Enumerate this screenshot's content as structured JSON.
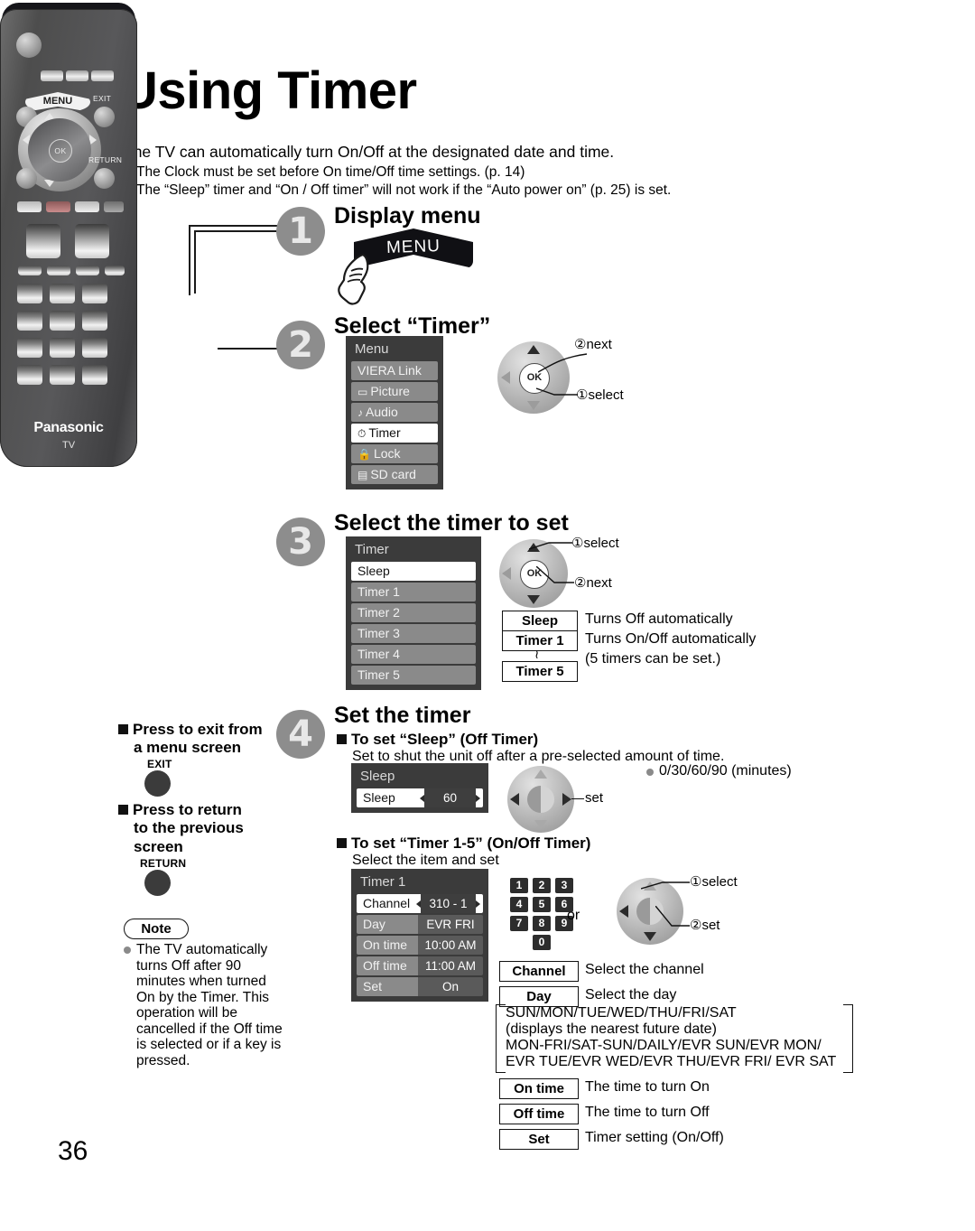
{
  "page": {
    "title": "Using Timer",
    "number": "36",
    "intro": "The TV can automatically turn On/Off at the designated date and time.",
    "intro_bullets": [
      "The Clock must be set before On time/Off time settings. (p. 14)",
      "The “Sleep” timer and “On / Off timer” will not work if the “Auto power on” (p. 25) is set."
    ]
  },
  "remote": {
    "menu_key": "MENU",
    "ok_key": "OK",
    "exit_key": "EXIT",
    "return_key": "RETURN",
    "brand": "Panasonic",
    "brand_sub": "TV"
  },
  "steps": [
    {
      "num": "1",
      "heading": "Display menu"
    },
    {
      "num": "2",
      "heading": "Select “Timer”"
    },
    {
      "num": "3",
      "heading": "Select the timer to set"
    },
    {
      "num": "4",
      "heading": "Set the timer"
    }
  ],
  "step1": {
    "button_label": "MENU"
  },
  "step2": {
    "osd_title": "Menu",
    "items": [
      {
        "icon": "",
        "label": "VIERA Link",
        "selected": false
      },
      {
        "icon": "▭",
        "label": "Picture",
        "selected": false
      },
      {
        "icon": "♪",
        "label": "Audio",
        "selected": false
      },
      {
        "icon": "⏱",
        "label": "Timer",
        "selected": true
      },
      {
        "icon": "🔒",
        "label": "Lock",
        "selected": false
      },
      {
        "icon": "▤",
        "label": "SD card",
        "selected": false
      }
    ],
    "dpad": {
      "ok": "OK",
      "callout_next": "②next",
      "callout_select": "①select"
    }
  },
  "step3": {
    "osd_title": "Timer",
    "items": [
      {
        "label": "Sleep",
        "selected": true
      },
      {
        "label": "Timer 1",
        "selected": false
      },
      {
        "label": "Timer 2",
        "selected": false
      },
      {
        "label": "Timer 3",
        "selected": false
      },
      {
        "label": "Timer 4",
        "selected": false
      },
      {
        "label": "Timer 5",
        "selected": false
      }
    ],
    "dpad": {
      "ok": "OK",
      "callout_select": "①select",
      "callout_next": "②next"
    },
    "legend": [
      {
        "key": "Sleep",
        "desc": "Turns Off automatically"
      },
      {
        "key": "Timer 1",
        "desc": "Turns On/Off automatically"
      },
      {
        "key": "",
        "desc": "(5 timers can be set.)"
      },
      {
        "key": "Timer 5",
        "desc": ""
      }
    ],
    "tilde": "≀"
  },
  "step4": {
    "sleep_section": {
      "heading": "To set “Sleep” (Off Timer)",
      "subtext": "Set to shut the unit off after a pre-selected amount of time.",
      "osd_title": "Sleep",
      "row_key": "Sleep",
      "row_value": "60",
      "dpad_callout": "set",
      "options_note": "0/30/60/90 (minutes)"
    },
    "timer_section": {
      "heading": "To set “Timer 1-5” (On/Off Timer)",
      "subtext": "Select the item and set",
      "osd_title": "Timer 1",
      "rows": [
        {
          "key": "Channel",
          "value": "310 - 1",
          "highlight": true,
          "arrows": true
        },
        {
          "key": "Day",
          "value": "EVR FRI",
          "highlight": false,
          "arrows": false
        },
        {
          "key": "On time",
          "value": "10:00 AM",
          "highlight": false,
          "arrows": false
        },
        {
          "key": "Off time",
          "value": "11:00 AM",
          "highlight": false,
          "arrows": false
        },
        {
          "key": "Set",
          "value": "On",
          "highlight": false,
          "arrows": false
        }
      ],
      "keypad": [
        "1",
        "2",
        "3",
        "4",
        "5",
        "6",
        "7",
        "8",
        "9",
        "0"
      ],
      "or_text": "or",
      "dpad": {
        "callout_select": "①select",
        "callout_set": "②set"
      }
    },
    "legend": [
      {
        "key": "Channel",
        "desc": "Select the channel"
      },
      {
        "key": "Day",
        "desc": "Select the day"
      },
      {
        "key": "On time",
        "desc": "The time to turn On"
      },
      {
        "key": "Off time",
        "desc": "The time to turn Off"
      },
      {
        "key": "Set",
        "desc": "Timer setting (On/Off)"
      }
    ],
    "day_options": [
      "SUN/MON/TUE/WED/THU/FRI/SAT",
      "(displays the nearest future date)",
      "MON-FRI/SAT-SUN/DAILY/EVR SUN/EVR MON/",
      "EVR TUE/EVR WED/EVR THU/EVR FRI/ EVR SAT"
    ]
  },
  "sidebar": {
    "exit_heading_line1": "Press to exit from",
    "exit_heading_line2": "a menu screen",
    "exit_button": "EXIT",
    "return_heading_line1": "Press to return",
    "return_heading_line2": "to the previous",
    "return_heading_line3": "screen",
    "return_button": "RETURN",
    "note_title": "Note",
    "note_text": "The TV automatically turns Off after 90 minutes when turned On by the Timer. This operation will be cancelled if the Off time is selected or if a key is pressed."
  }
}
